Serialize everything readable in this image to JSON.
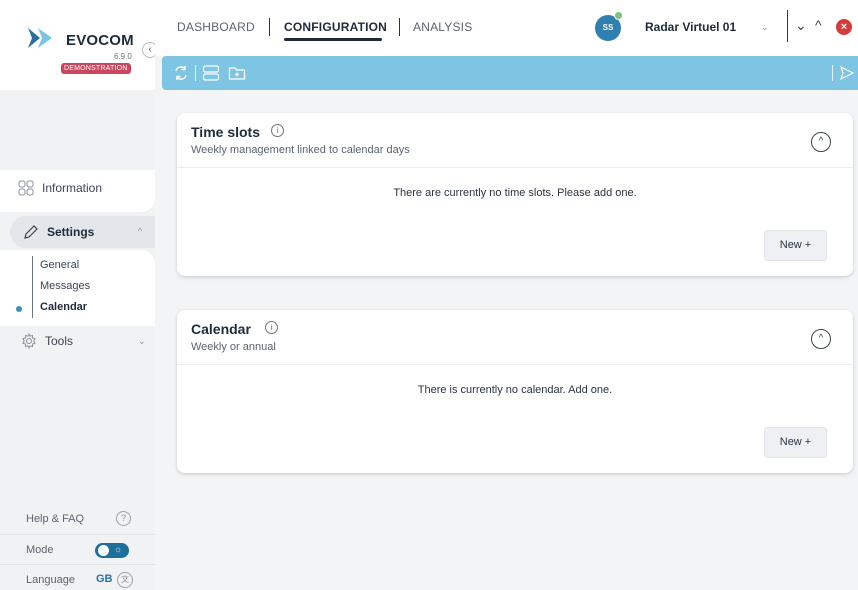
{
  "brand": {
    "name": "EVOCOM",
    "version": "6.9.0",
    "badge": "DEMONSTRATION",
    "collapse_glyph": "‹",
    "logo_colors": [
      "#2a6f9e",
      "#7ec4e3"
    ]
  },
  "sidebar": {
    "items": [
      {
        "label": "Information",
        "icon": "grid-icon"
      },
      {
        "label": "Settings",
        "icon": "pencil-icon",
        "expanded": true
      },
      {
        "label": "Tools",
        "icon": "gear-icon",
        "expanded": false
      }
    ],
    "settings_sub": [
      {
        "label": "General"
      },
      {
        "label": "Messages"
      },
      {
        "label": "Calendar",
        "active": true
      }
    ],
    "chev_up": "^",
    "chev_down": "⌄"
  },
  "footer": {
    "help_label": "Help & FAQ",
    "help_glyph": "?",
    "mode_label": "Mode",
    "mode_glyph": "☼",
    "language_label": "Language",
    "language_code": "GB",
    "language_glyph": "文"
  },
  "topbar": {
    "tabs": [
      {
        "label": "DASHBOARD"
      },
      {
        "label": "CONFIGURATION",
        "active": true
      },
      {
        "label": "ANALYSIS"
      }
    ],
    "avatar_initials": "SS",
    "radar_name": "Radar Virtuel 01",
    "radar_chev": "⌄",
    "win_down": "⌄",
    "win_up": "^",
    "win_close": "×"
  },
  "toolbar": {
    "icons": [
      "refresh-icon",
      "list-icon",
      "add-folder-icon",
      "send-icon"
    ],
    "color": "#7ec4e3"
  },
  "cards": {
    "time_slots": {
      "title": "Time slots",
      "info_glyph": "i",
      "subtitle": "Weekly management linked to calendar days",
      "collapse_glyph": "^",
      "empty_text": "There are currently no time slots. Please add one.",
      "new_label": "New +"
    },
    "calendar": {
      "title": "Calendar",
      "info_glyph": "i",
      "subtitle": "Weekly or annual",
      "collapse_glyph": "^",
      "empty_text": "There is currently no calendar. Add one.",
      "new_label": "New +"
    }
  }
}
